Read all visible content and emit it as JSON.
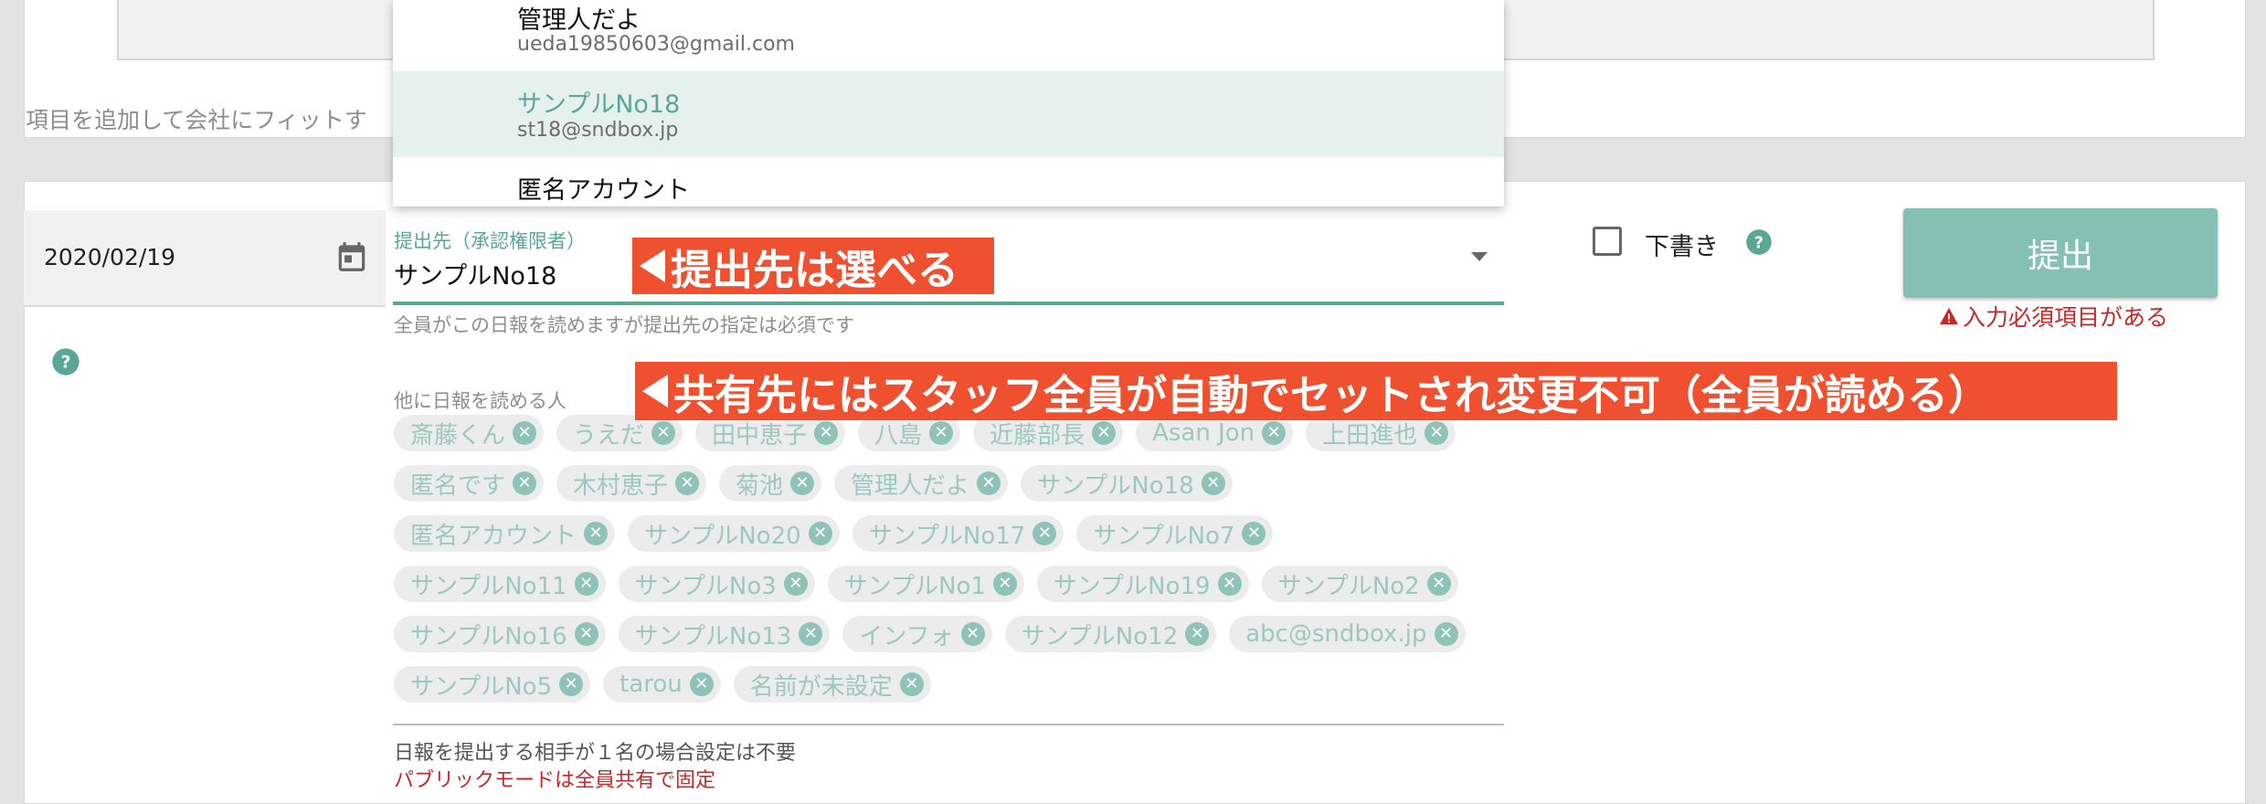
{
  "top_section": {
    "hint_text": "項目を追加して会社にフィットす"
  },
  "date_field": {
    "value": "2020/02/19",
    "icon": "calendar-icon"
  },
  "submit_to": {
    "label": "提出先（承認権限者）",
    "value": "サンプルNo18",
    "helper": "全員がこの日報を読めますが提出先の指定は必須です"
  },
  "dropdown_menu": {
    "items": [
      {
        "name": "管理人だよ",
        "email": "ueda19850603@gmail.com",
        "selected": false
      },
      {
        "name": "サンプルNo18",
        "email": "st18@sndbox.jp",
        "selected": true
      },
      {
        "name": "匿名アカウント",
        "email": "",
        "selected": false
      }
    ]
  },
  "readers": {
    "label": "他に日報を読める人",
    "rows": [
      [
        "斎藤くん",
        "うえだ",
        "田中恵子",
        "八島",
        "近藤部長",
        "Asan Jon",
        "上田進也"
      ],
      [
        "匿名です",
        "木村恵子",
        "菊池",
        "管理人だよ",
        "サンプルNo18"
      ],
      [
        "匿名アカウント",
        "サンプルNo20",
        "サンプルNo17",
        "サンプルNo7"
      ],
      [
        "サンプルNo11",
        "サンプルNo3",
        "サンプルNo1",
        "サンプルNo19",
        "サンプルNo2"
      ],
      [
        "サンプルNo16",
        "サンプルNo13",
        "インフォ",
        "サンプルNo12",
        "abc@sndbox.jp"
      ],
      [
        "サンプルNo5",
        "tarou",
        "名前が未設定"
      ]
    ],
    "note": "日報を提出する相手が１名の場合設定は不要",
    "note_red": "パブリックモードは全員共有で固定"
  },
  "draft": {
    "label": "下書き",
    "checked": false
  },
  "submit": {
    "label": "提出",
    "warning": "入力必須項目がある"
  },
  "annotations": {
    "submit_to_note": "提出先は選べる",
    "share_note": "共有先にはスタッフ全員が自動でセットされ変更不可（全員が読める）"
  },
  "colors": {
    "accent": "#5aa797",
    "button": "#84c1b4",
    "error": "#c62828",
    "annotation": "#ef5030"
  }
}
